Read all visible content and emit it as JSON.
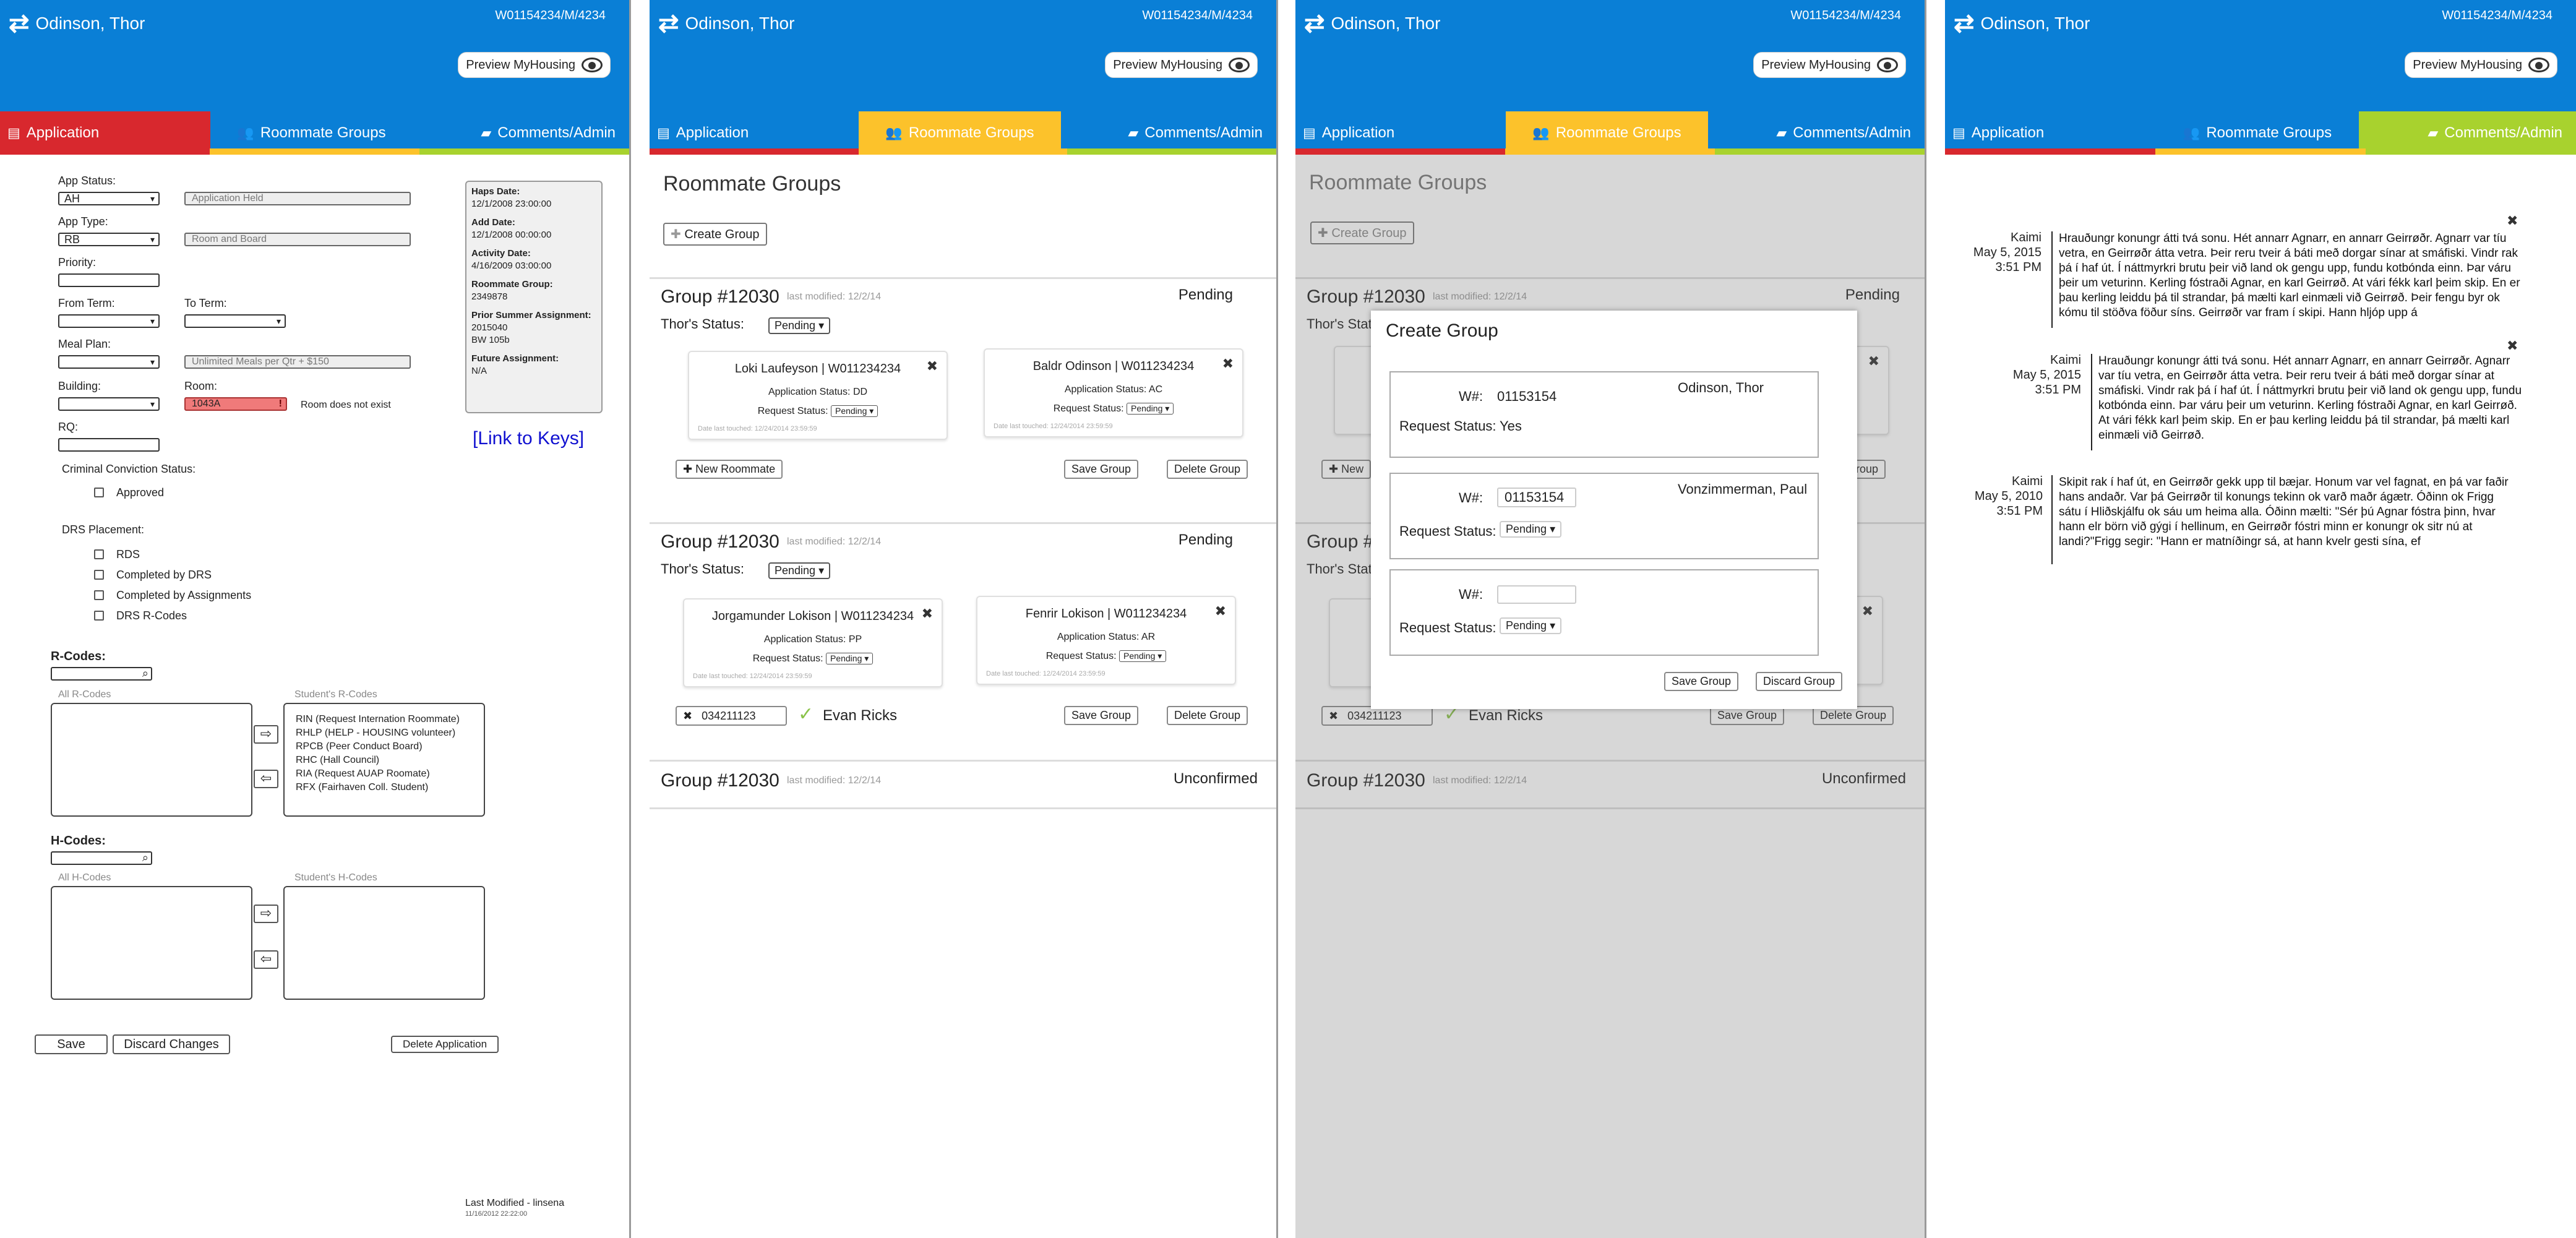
{
  "header": {
    "student_name": "Odinson, Thor",
    "student_id": "W01154234/M/4234",
    "preview_label": "Preview MyHousing"
  },
  "tabs": [
    "Application",
    "Roommate Groups",
    "Comments/Admin"
  ],
  "colors": {
    "blue": "#0a7fd6",
    "red": "#d8282e",
    "yellow": "#fcc22b",
    "lime": "#a8d22e"
  },
  "icons": {
    "swap": "swap-arrows-icon",
    "eye": "eye-icon",
    "application": "document-icon",
    "roommates": "people-icon",
    "comments": "speech-bubble-icon",
    "close": "close-icon",
    "check": "checkmark-icon",
    "plus": "plus-icon",
    "search": "search-icon"
  },
  "application": {
    "app_status_label": "App Status:",
    "app_status_value": "AH",
    "app_status_desc": "Application Held",
    "app_type_label": "App Type:",
    "app_type_value": "RB",
    "app_type_desc": "Room and Board",
    "priority_label": "Priority:",
    "from_term_label": "From Term:",
    "to_term_label": "To Term:",
    "meal_plan_label": "Meal Plan:",
    "meal_plan_desc": "Unlimited Meals per Qtr + $150",
    "building_label": "Building:",
    "room_label": "Room:",
    "room_value": "1043A",
    "room_error_icon": "!",
    "room_error": "Room does not exist",
    "rq_label": "RQ:",
    "criminal_label": "Criminal Conviction Status:",
    "approved_label": "Approved",
    "drs_label": "DRS Placement:",
    "drs_options": [
      "RDS",
      "Completed by DRS",
      "Completed by Assignments",
      "DRS R-Codes"
    ],
    "rcodes_label": "R-Codes:",
    "all_rcodes_label": "All R-Codes",
    "student_rcodes_label": "Student's R-Codes",
    "student_rcodes": [
      "RIN (Request Internation Roommate)",
      "RHLP (HELP - HOUSING volunteer)",
      "RPCB (Peer Conduct Board)",
      "RHC (Hall Council)",
      "RIA (Request AUAP Roomate)",
      "RFX (Fairhaven Coll. Student)"
    ],
    "hcodes_label": "H-Codes:",
    "all_hcodes_label": "All H-Codes",
    "student_hcodes_label": "Student's H-Codes",
    "save_label": "Save",
    "discard_label": "Discard Changes",
    "delete_label": "Delete Application",
    "last_modified": "Last Modified - linsena",
    "last_modified_date": "11/16/2012 22:22:00",
    "link_keys": "[Link to Keys]",
    "info": {
      "haps_date_label": "Haps Date:",
      "haps_date": "12/1/2008 23:00:00",
      "add_date_label": "Add Date:",
      "add_date": "12/1/2008 00:00:00",
      "activity_date_label": "Activity Date:",
      "activity_date": "4/16/2009 03:00:00",
      "roommate_group_label": "Roommate Group:",
      "roommate_group": "2349878",
      "prior_summer_label": "Prior Summer Assignment:",
      "prior_summer_1": "2015040",
      "prior_summer_2": "BW 105b",
      "future_label": "Future Assignment:",
      "future": "N/A"
    }
  },
  "roommates": {
    "title": "Roommate Groups",
    "create_label": "Create Group",
    "status_label": "Thor's Status:",
    "pending": "Pending",
    "unconfirmed": "Unconfirmed",
    "app_status_prefix": "Application Status:",
    "request_status_label": "Request Status:",
    "date_touched": "Date last touched: 12/24/2014 23:59:59",
    "new_roommate": "New Roommate",
    "save_group": "Save Group",
    "delete_group": "Delete Group",
    "group_title": "Group #12030",
    "last_modified": "last modified: 12/2/14",
    "group1": [
      {
        "name": "Loki Laufeyson | W011234234",
        "status": "DD"
      },
      {
        "name": "Baldr Odinson | W011234234",
        "status": "AC"
      }
    ],
    "group2": [
      {
        "name": "Jorgamunder  Lokison | W011234234",
        "status": "PP"
      },
      {
        "name": "Fenrir Lokison | W011234234",
        "status": "AR"
      }
    ],
    "added_w": "034211123",
    "added_name": "Evan Ricks"
  },
  "modal": {
    "title": "Create Group",
    "w_label": "W#:",
    "request_status_label": "Request Status:",
    "row1": {
      "w": "01153154",
      "name": "Odinson, Thor",
      "status": "Yes"
    },
    "row2": {
      "w": "01153154",
      "name": "Vonzimmerman, Paul",
      "status": "Pending"
    },
    "row3": {
      "w": "",
      "status": "Pending"
    },
    "save": "Save Group",
    "discard": "Discard Group"
  },
  "comments": [
    {
      "author": "Kaimi",
      "date": "May 5, 2015",
      "time": "3:51 PM",
      "text": "Hrauðungr konungr átti tvá sonu. Hét annarr Agnarr, en annarr Geirrøðr. Agnarr var tíu vetra, en Geirrøðr átta vetra. Þeir reru tveir á báti með dorgar sínar at smáfiski. Vindr rak þá í haf út. Í náttmyrkri brutu þeir við land ok gengu upp, fundu kotbónda einn. Þar váru þeir um veturinn. Kerling fóstraði Agnar, en karl Geirrøð. At vári fékk karl þeim skip. En er þau kerling leiddu þá til strandar, þá mælti karl einmæli við Geirrøð. Þeir fengu byr ok kómu til stöðva föður síns. Geirrøðr var fram í skipi. Hann hljóp upp á"
    },
    {
      "author": "Kaimi",
      "date": "May 5, 2015",
      "time": "3:51 PM",
      "text": "Hrauðungr konungr átti tvá sonu. Hét annarr Agnarr, en annarr Geirrøðr. Agnarr var tíu vetra, en Geirrøðr átta vetra. Þeir reru tveir á báti með dorgar sínar at smáfiski. Vindr rak þá í haf út. Í náttmyrkri brutu þeir við land ok gengu upp, fundu kotbónda einn. Þar váru þeir um veturinn. Kerling fóstraði Agnar, en karl Geirrøð. At vári fékk karl þeim skip. En er þau kerling leiddu þá til strandar, þá mælti karl einmæli við Geirrøð."
    },
    {
      "author": "Kaimi",
      "date": "May 5, 2010",
      "time": "3:51 PM",
      "text": "Skipit rak í haf út, en Geirrøðr gekk upp til bæjar. Honum var vel fagnat, en þá var faðir hans andaðr. Var þá Geirrøðr til konungs tekinn ok varð maðr ágætr. Óðinn ok Frigg sátu í Hliðskjálfu ok sáu um heima alla. Óðinn mælti: \"Sér þú Agnar fóstra þinn, hvar hann elr börn við gýgi í hellinum, en Geirrøðr fóstri minn er konungr ok sitr nú at landi?\"Frigg segir: \"Hann er matníðingr sá, at hann kvelr gesti sína, ef"
    }
  ]
}
